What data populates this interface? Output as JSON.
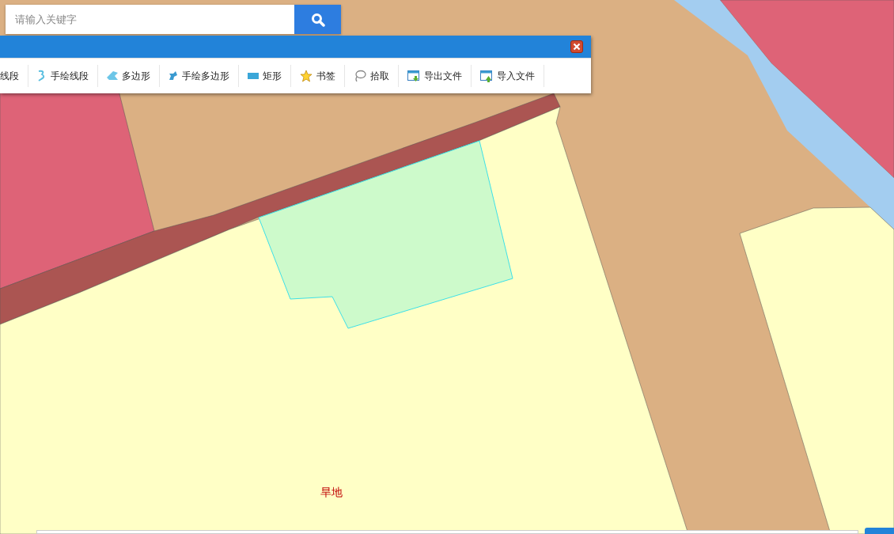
{
  "search": {
    "placeholder": "请输入关键字"
  },
  "toolbar": {
    "items": [
      {
        "label": "线段"
      },
      {
        "label": "手绘线段"
      },
      {
        "label": "多边形"
      },
      {
        "label": "手绘多边形"
      },
      {
        "label": "矩形"
      },
      {
        "label": "书签"
      },
      {
        "label": "拾取"
      },
      {
        "label": "导出文件"
      },
      {
        "label": "导入文件"
      }
    ]
  },
  "map": {
    "labels": [
      "旱地"
    ]
  }
}
